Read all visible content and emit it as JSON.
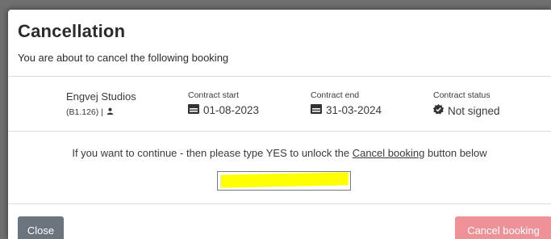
{
  "dialog": {
    "title": "Cancellation",
    "subtitle": "You are about to cancel the following booking"
  },
  "booking": {
    "name": "Engvej Studios",
    "code": "(B1.126) |",
    "contract_start_label": "Contract start",
    "contract_start": "01-08-2023",
    "contract_end_label": "Contract end",
    "contract_end": "31-03-2024",
    "contract_status_label": "Contract status",
    "contract_status": "Not signed"
  },
  "instruction": {
    "before": "If you want to continue - then please type YES to unlock the ",
    "link": "Cancel booking",
    "after": " button below"
  },
  "confirm": {
    "value": ""
  },
  "buttons": {
    "close": "Close",
    "cancel_booking": "Cancel booking"
  },
  "colors": {
    "close": "#6c757d",
    "cancel_booking": "#ee9298",
    "highlight": "#ffff00"
  }
}
